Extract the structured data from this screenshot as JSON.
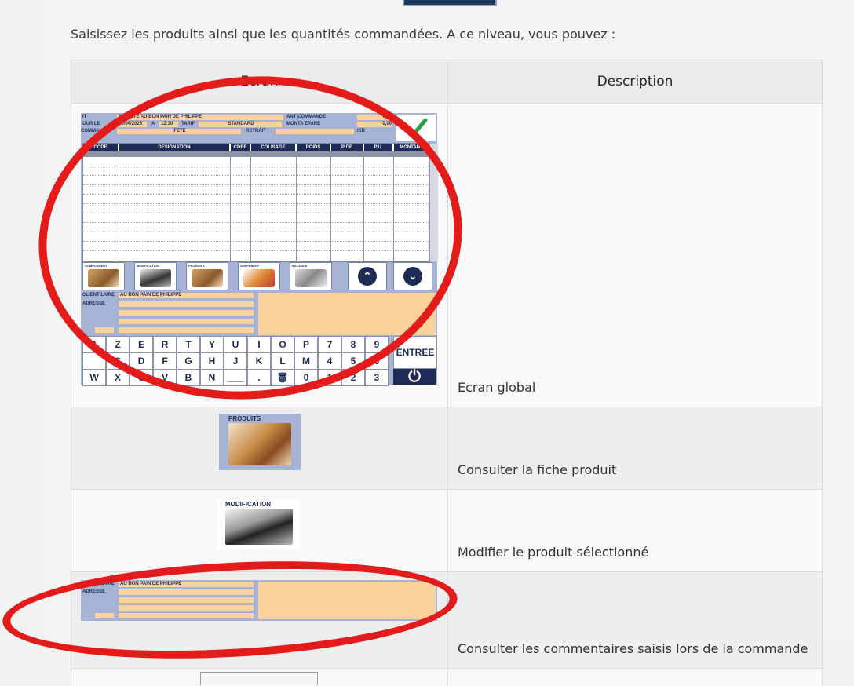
{
  "intro": "Saisissez les produits ainsi que les quantités commandées. A ce niveau, vous pouvez :",
  "table": {
    "headers": [
      "Ecran",
      "Description"
    ],
    "rows": [
      {
        "description": "Ecran global"
      },
      {
        "description": "Consulter la fiche produit"
      },
      {
        "description": "Modifier le produit sélectionné"
      },
      {
        "description": "Consulter les commentaires saisis lors de la commande"
      }
    ]
  },
  "pos": {
    "header": {
      "client_label": "IT",
      "client_value": "SOCIETE AU BON PAIN DE PHILIPPE",
      "pour_le_label": "OUR LE",
      "date": "30/04/2025",
      "a_label": "A",
      "time": "12:30",
      "tarif_label": "TARIF",
      "tarif_value": "STANDARD",
      "commande_label": "COMMANDE",
      "commande_value": "FETE",
      "retrait_label": "RETRAIT",
      "montant_commande_label": "ANT COMMANDE",
      "montant_commande_value": "0,00",
      "montant_prepare_label": "MONTA  EPARE",
      "montant_prepare_value": "0,00",
      "imprimer_label": "IER"
    },
    "columns": [
      "CODE",
      "DESIGNATION",
      "CDEE",
      "COLISAGE",
      "POIDS",
      "P  DE",
      "P.U.",
      "MONTANT"
    ],
    "tools": [
      "COMPLEMENT",
      "MODIFICATION",
      "PRODUITS",
      "SUPPRIMER",
      "BALANCE"
    ],
    "client_livre_label": "CLIENT LIVRE",
    "client_livre_value": "AU BON PAIN DE PHILIPPE",
    "adresse_label": "ADRESSE",
    "keys_row1": [
      "A",
      "Z",
      "E",
      "R",
      "T",
      "Y",
      "U",
      "I",
      "O",
      "P",
      "7",
      "8",
      "9"
    ],
    "keys_row2": [
      "",
      "S",
      "D",
      "F",
      "G",
      "H",
      "J",
      "K",
      "L",
      "M",
      "4",
      "5",
      "6"
    ],
    "keys_row3": [
      "W",
      "X",
      "C",
      "V",
      "B",
      "N",
      "___",
      ".",
      "🗑",
      "0",
      "1",
      "2",
      "3"
    ],
    "entree_label": "ENTREE",
    "power_symbol": "⏻",
    "up_symbol": "⌃",
    "down_symbol": "⌄"
  },
  "thumbs": {
    "produits": "PRODUITS",
    "modification": "MODIFICATION"
  },
  "colors": {
    "annotation": "#e31b1b",
    "field": "#fcd29c",
    "panel": "#a7b3d4",
    "navy": "#1d2b56"
  }
}
